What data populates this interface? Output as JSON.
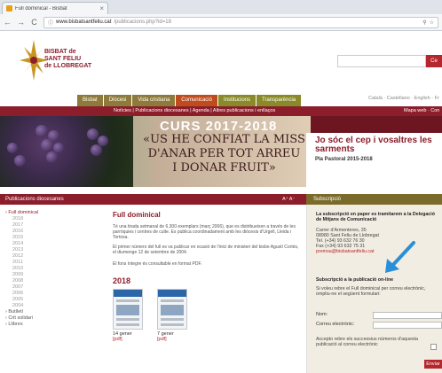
{
  "browser": {
    "tab_title": "Full dominical - Bisbat",
    "tab_close": "×",
    "url_host": "www.bisbatsantfeliu.cat",
    "url_path": "/publicacions.php?id=18",
    "back": "←",
    "forward": "→",
    "reload": "C",
    "search_icon_glyph": "⚲",
    "star_glyph": "☆"
  },
  "site": {
    "logo_line1": "BISBAT de",
    "logo_line2": "SANT FELIU",
    "logo_line3": "de LLOBREGAT",
    "search_button": "Ce"
  },
  "main_nav": [
    "Bisbat",
    "Diòcesi",
    "Vida cristiana",
    "Comunicació",
    "Institucions",
    "Transparència"
  ],
  "main_nav_active": "Comunicació",
  "lang_links": "Català · Castellano · English · Fr",
  "sub_nav": {
    "items": "Notícies | Publicacions diocesanes | Agenda | Altres publicacions i enllaços",
    "right": "Mapa web · Con"
  },
  "banner": {
    "year": "CURS 2017-2018",
    "quote_line1": "«US HE CONFIAT LA MISS",
    "quote_line2": "D'ANAR PER TOT ARREU",
    "quote_line3": "I DONAR FRUIT»",
    "title_line1": "Jo sóc el cep i vosaltres les",
    "title_line2": "sarments",
    "subtitle": "Pla Pastoral 2015-2018"
  },
  "section_bar": {
    "title": "Publicacions diocesanes",
    "font_size_ctrl": "A⁺ A⁻"
  },
  "sidebar": {
    "head": "Full dominical",
    "years": [
      "2018",
      "2017",
      "2016",
      "2015",
      "2014",
      "2013",
      "2012",
      "2011",
      "2010",
      "2009",
      "2008",
      "2007",
      "2006",
      "2005",
      "2004"
    ],
    "others": [
      "Butlletí",
      "Crit solidari",
      "Llibres"
    ]
  },
  "content": {
    "title": "Full dominical",
    "p1": "Té una tirada setmanal de 6.300 exemplars (març 2006), que es distribueixen a través de les parròquies i centres de culte. Es publica coordinadament amb les diòcesis d'Urgell, Lleida i Tortosa.",
    "p2": "El primer número del full es va publicar en ocasió de l'inici de ministeri del bisbe Agustí Cortés, el diumenge 12 de setembre de 2004.",
    "p3": "El fons íntegre és consultable en format PDF.",
    "year": "2018",
    "issues": [
      {
        "date": "14 gener",
        "format": "[pdf]"
      },
      {
        "date": "7 gener",
        "format": "[pdf]"
      }
    ]
  },
  "subscription": {
    "header": "Subscripció",
    "p1": "La subscripció en paper es tramitarem a la Delegació de Mitjans de Comunicació",
    "addr1": "Carrer d'Armenteres, 35",
    "addr2": "08980 Sant Feliu de Llobregat",
    "tel": "Tel. (+34) 93 632 76 30",
    "fax": "Fax (+34) 93 632 75 31",
    "email": "premsa@bisbatsantfeliu.cat",
    "online_title": "Subscripció a la publicació on-line",
    "online_p": "Si voleu rebre el Full dominical per correu electrònic, ompliu-ne el següent formulari:",
    "name_label": "Nom:",
    "email_label": "Correu electrònic:",
    "accept": "Accepto rebre els successius números d'aquesta publicació al correu electrònic",
    "submit": "Enviar"
  },
  "colors": {
    "brand": "#8c1d2b",
    "nav_active": "#c04c1e",
    "accent_red": "#b5262d",
    "arrow": "#2a8fd6"
  }
}
